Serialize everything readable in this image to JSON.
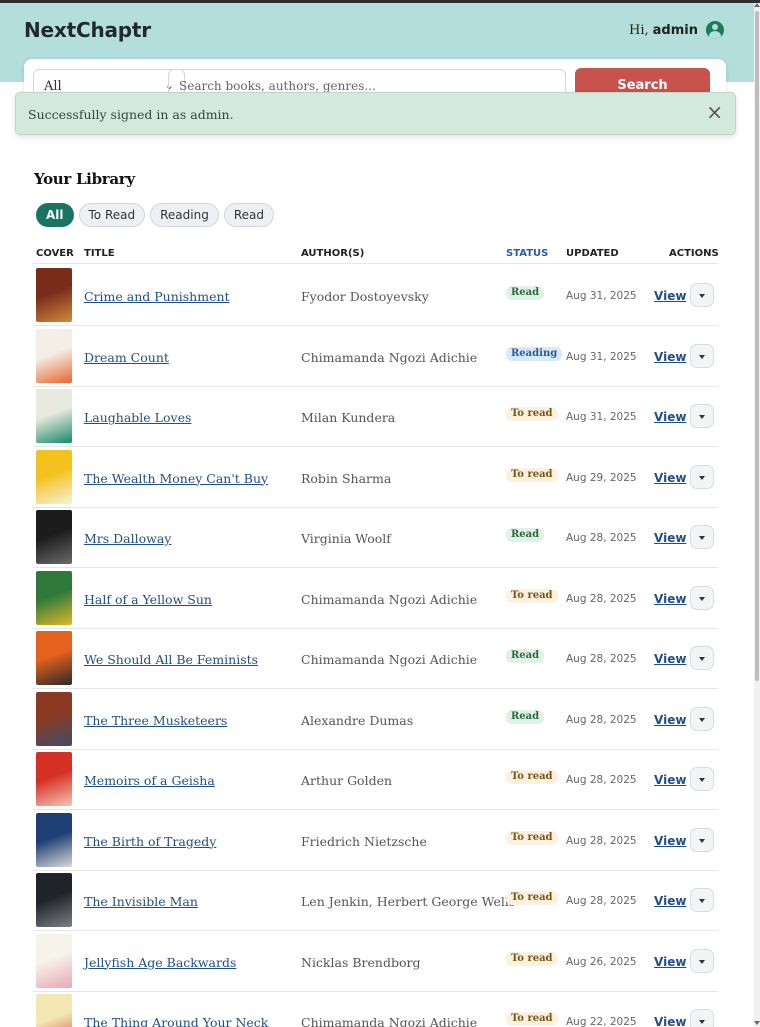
{
  "app": {
    "brand": "NextChaptr",
    "greeting": "Hi,",
    "username": "admin"
  },
  "search": {
    "category": "All",
    "placeholder": "Search books, authors, genres...",
    "button": "Search"
  },
  "toast": {
    "message": "Successfully signed in as admin.",
    "close": "×"
  },
  "library": {
    "heading": "Your Library",
    "filters": [
      "All",
      "To Read",
      "Reading",
      "Read"
    ],
    "active_filter": "All",
    "columns": {
      "cover": "COVER",
      "title": "TITLE",
      "authors": "AUTHOR(S)",
      "status": "STATUS",
      "updated": "UPDATED",
      "actions": "ACTIONS"
    },
    "view_label": "View",
    "rows": [
      {
        "title": "Crime and Punishment",
        "author": "Fyodor Dostoyevsky",
        "status": "Read",
        "status_key": "read",
        "updated": "Aug 31, 2025",
        "cover_colors": [
          "#7a2c1a",
          "#d08a3a"
        ]
      },
      {
        "title": "Dream Count",
        "author": "Chimamanda Ngozi Adichie",
        "status": "Reading",
        "status_key": "reading",
        "updated": "Aug 31, 2025",
        "cover_colors": [
          "#f3efe6",
          "#e8662d"
        ]
      },
      {
        "title": "Laughable Loves",
        "author": "Milan Kundera",
        "status": "To read",
        "status_key": "toread",
        "updated": "Aug 31, 2025",
        "cover_colors": [
          "#e9eadf",
          "#17896b"
        ]
      },
      {
        "title": "The Wealth Money Can't Buy",
        "author": "Robin Sharma",
        "status": "To read",
        "status_key": "toread",
        "updated": "Aug 29, 2025",
        "cover_colors": [
          "#f3c21f",
          "#f7f1dc"
        ]
      },
      {
        "title": "Mrs Dalloway",
        "author": "Virginia Woolf",
        "status": "Read",
        "status_key": "read",
        "updated": "Aug 28, 2025",
        "cover_colors": [
          "#1c1c1c",
          "#6a6a6a"
        ]
      },
      {
        "title": "Half of a Yellow Sun",
        "author": "Chimamanda Ngozi Adichie",
        "status": "To read",
        "status_key": "toread",
        "updated": "Aug 28, 2025",
        "cover_colors": [
          "#2f7a3a",
          "#e0b629"
        ]
      },
      {
        "title": "We Should All Be Feminists",
        "author": "Chimamanda Ngozi Adichie",
        "status": "Read",
        "status_key": "read",
        "updated": "Aug 28, 2025",
        "cover_colors": [
          "#e4611e",
          "#2a2a2a"
        ]
      },
      {
        "title": "The Three Musketeers",
        "author": "Alexandre Dumas",
        "status": "Read",
        "status_key": "read",
        "updated": "Aug 28, 2025",
        "cover_colors": [
          "#8a3a22",
          "#3d4d6d"
        ]
      },
      {
        "title": "Memoirs of a Geisha",
        "author": "Arthur Golden",
        "status": "To read",
        "status_key": "toread",
        "updated": "Aug 28, 2025",
        "cover_colors": [
          "#d62f24",
          "#f0c7b2"
        ]
      },
      {
        "title": "The Birth of Tragedy",
        "author": "Friedrich Nietzsche",
        "status": "To read",
        "status_key": "toread",
        "updated": "Aug 28, 2025",
        "cover_colors": [
          "#1d3f73",
          "#d9d9d9"
        ]
      },
      {
        "title": "The Invisible Man",
        "author": "Len Jenkin, Herbert George Wells",
        "status": "To read",
        "status_key": "toread",
        "updated": "Aug 28, 2025",
        "cover_colors": [
          "#202327",
          "#7b7f86"
        ]
      },
      {
        "title": "Jellyfish Age Backwards",
        "author": "Nicklas Brendborg",
        "status": "To read",
        "status_key": "toread",
        "updated": "Aug 26, 2025",
        "cover_colors": [
          "#f6f3ea",
          "#e9a8b5"
        ]
      },
      {
        "title": "The Thing Around Your Neck",
        "author": "Chimamanda Ngozi Adichie",
        "status": "To read",
        "status_key": "toread",
        "updated": "Aug 22, 2025",
        "cover_colors": [
          "#f3e7b3",
          "#d44b35"
        ]
      }
    ]
  }
}
